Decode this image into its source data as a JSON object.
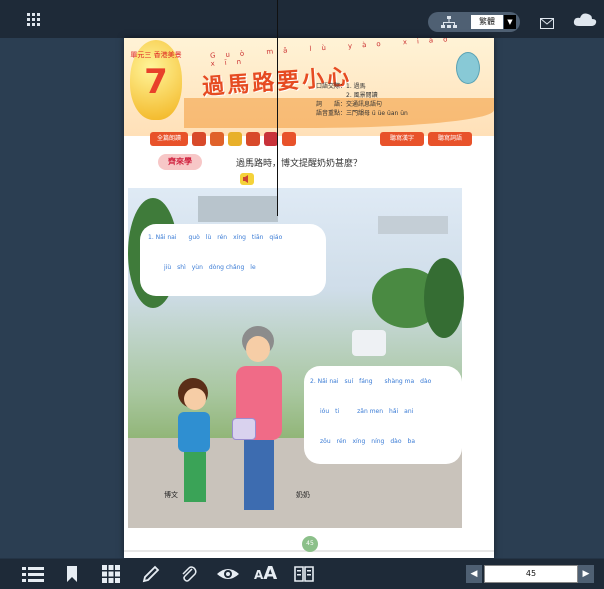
{
  "topbar": {
    "grid_icon": "grid-icon",
    "language_select": {
      "selected": "繁體"
    },
    "mail_icon": "mail-icon",
    "cloud_icon": "cloud-icon"
  },
  "book": {
    "lesson_label": "單元三 香港美景",
    "lesson_number": "7",
    "title": "過馬路要小心",
    "title_pinyin": "Guò mǎ lù yào xiǎo xīn",
    "info": [
      "口語交際：1. 過馬",
      "　　　　　2. 風景閱讀",
      "詞　　語：交通訊息語句",
      "語音重點：三門韻母 ü üe üan ün"
    ],
    "tools": [
      "全篇朗讀",
      "",
      "",
      "",
      "",
      "",
      "",
      "聽寫漢字",
      "聽寫詞語"
    ],
    "question_badge": "齊來學",
    "question_text": "過馬路時，博文提醒奶奶甚麼？",
    "bubble1": {
      "line1": "1. Nǎi nai　　guò　lù　rén　xíng　tiān　qiáo",
      "line2": "jiù　shì　yùn　dòng chǎng　le"
    },
    "bubble2": {
      "line1": "2. Nǎi nai　suí　fáng　　shàng ma　dào",
      "line2": "ióu　ti　　　zǎn men　hǎi　ani",
      "line3": "zǒu　rén　xíng　níng　dào　ba"
    },
    "caption_boy": "博文",
    "caption_grandma": "奶奶",
    "page_badge": "45"
  },
  "bottombar": {
    "page_input": "45"
  }
}
